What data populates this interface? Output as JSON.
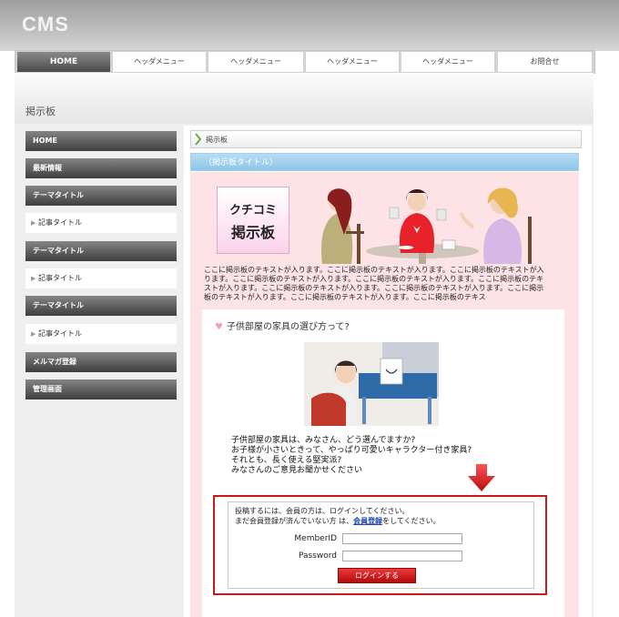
{
  "header": {
    "logo": "CMS"
  },
  "nav": {
    "items": [
      "HOME",
      "ヘッダメニュー",
      "ヘッダメニュー",
      "ヘッダメニュー",
      "ヘッダメニュー",
      "お問合せ"
    ]
  },
  "page": {
    "heading": "掲示板"
  },
  "sidebar": {
    "items": [
      {
        "label": "HOME",
        "style": "dark"
      },
      {
        "label": "最新情報",
        "style": "dark"
      },
      {
        "label": "テーマタイトル",
        "style": "dark"
      },
      {
        "label": "記事タイトル",
        "style": "light"
      },
      {
        "label": "テーマタイトル",
        "style": "dark"
      },
      {
        "label": "記事タイトル",
        "style": "light"
      },
      {
        "label": "テーマタイトル",
        "style": "dark"
      },
      {
        "label": "記事タイトル",
        "style": "light"
      },
      {
        "label": "メルマガ登録",
        "style": "dark"
      },
      {
        "label": "管理画面",
        "style": "dark"
      }
    ]
  },
  "main": {
    "breadcrumb": "掲示板",
    "bbs_title": "（掲示板タイトル）",
    "banner": {
      "line1": "クチコミ",
      "line2": "掲示板"
    },
    "intro_lines": [
      "ここに掲示板のテキストが入ります。ここに掲示板のテキストが入ります。ここに掲示板のテキストが入",
      "ります。ここに掲示板のテキストが入ります。ここに掲示板のテキストが入ります。ここに掲示板のテキ",
      "ストが入ります。ここに掲示板のテキストが入ります。ここに掲示板のテキストが入ります。ここに掲示",
      "板のテキストが入ります。ここに掲示板のテキストが入ります。ここに掲示板のテキス"
    ],
    "question": {
      "title": "子供部屋の家具の選び方って?",
      "body": [
        "子供部屋の家具は、みなさん、どう選んでますか?",
        "お子様が小さいときって、やっぱり可愛いキャラクター付き家具?",
        "それとも、長く使える堅実派?",
        "みなさんのご意見お聞かせください"
      ]
    },
    "login": {
      "line1": "投稿するには、会員の方は、ログインしてください。",
      "line2_before": "まだ会員登録が済んでいない方 は、",
      "register_link": "会員登録",
      "line2_after": "をしてください。",
      "member_id_label": "MemberID",
      "member_id_value": "",
      "password_label": "Password",
      "password_value": "",
      "button": "ログインする"
    }
  },
  "colors": {
    "accent_red": "#c8191b",
    "bbs_bar": "#8cc6ea",
    "panel_pink": "#fde3e5"
  }
}
